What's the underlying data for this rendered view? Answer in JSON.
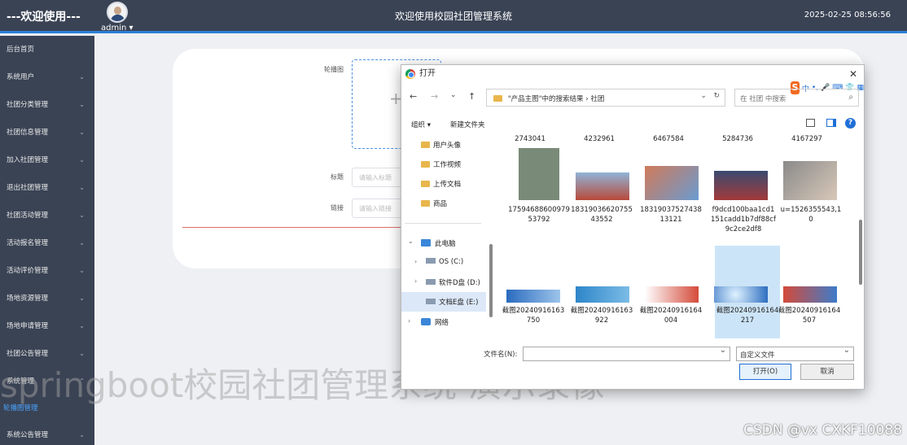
{
  "topbar": {
    "brand": "---欢迎使用---",
    "user": "admin",
    "site_title": "欢迎使用校园社团管理系统",
    "clock": "2025-02-25 08:56:56",
    "accent": "#2b7fd8",
    "bg": "#3a4354"
  },
  "sidebar": {
    "items": [
      {
        "label": "后台首页"
      },
      {
        "label": "系统用户"
      },
      {
        "label": "社团分类管理"
      },
      {
        "label": "社团信息管理"
      },
      {
        "label": "加入社团管理"
      },
      {
        "label": "退出社团管理"
      },
      {
        "label": "社团活动管理"
      },
      {
        "label": "活动报名管理"
      },
      {
        "label": "活动评价管理"
      },
      {
        "label": "场地资源管理"
      },
      {
        "label": "场地申请管理"
      },
      {
        "label": "社团公告管理"
      },
      {
        "label": "系统管理"
      }
    ],
    "sub_item": "轮播图管理",
    "last_item": "系统公告管理"
  },
  "form": {
    "carousel_label": "轮播图",
    "title_label": "标题",
    "title_placeholder": "请输入标题",
    "link_label": "链接",
    "link_placeholder": "请输入链接"
  },
  "watermark": "springboot校园社团管理系统 演示录像",
  "csdn": "CSDN @vx CXKF10088",
  "dialog": {
    "title": "打开",
    "address_path": "\"产品主图\"中的搜索结果  ›  社团",
    "search_placeholder": "在 社团 中搜索",
    "organize": "组织 ▾",
    "new_folder": "新建文件夹",
    "ime": [
      "中",
      "•,",
      "🎤",
      "⌨",
      "👕",
      "▦"
    ],
    "nav_folders": [
      "用户头像",
      "工作视频",
      "上传文档",
      "商品"
    ],
    "this_pc": "此电脑",
    "drives": [
      "OS (C:)",
      "软件D盘 (D:)",
      "文档E盘 (E:)"
    ],
    "network": "网络",
    "cut_names": [
      "2743041",
      "4232961",
      "6467584",
      "5284736",
      "4167297"
    ],
    "row1": [
      {
        "name": "1759468860097953792",
        "color": "#7a8a78"
      },
      {
        "name": "1831903662075543552",
        "color": "#b84a3a"
      },
      {
        "name": "1831903752743813121",
        "color": "#d07a5a"
      },
      {
        "name": "f9dcd100baa1cd1151cadd1b7df88cf9c2ce2df8",
        "color": "#3a4a70"
      },
      {
        "name": "u=1526355543,10",
        "color": "#8a8a8a"
      }
    ],
    "row2": [
      {
        "name": "截图20240916163750",
        "color": "#3d7cc9"
      },
      {
        "name": "截图20240916163922",
        "color": "#2e86c9"
      },
      {
        "name": "截图20240916164004",
        "color": "#d44a3a"
      },
      {
        "name": "截图20240916164217",
        "color": "#2a6bbf"
      },
      {
        "name": "截图20240916164507",
        "color": "#3d7cc9"
      }
    ],
    "filename_label": "文件名(N):",
    "filter": "自定义文件",
    "open_btn": "打开(O)",
    "cancel_btn": "取消"
  }
}
